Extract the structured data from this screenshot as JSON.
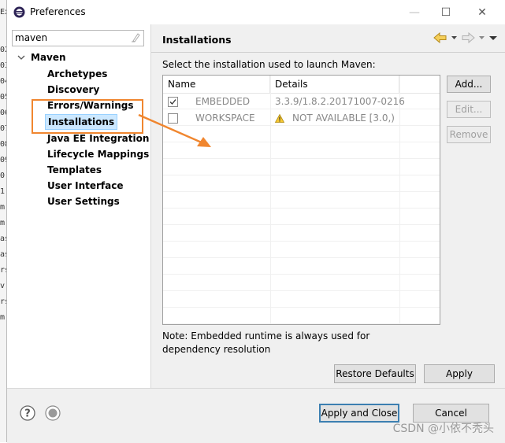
{
  "window": {
    "title": "Preferences",
    "controls": {
      "minimize": "—",
      "maximize": "☐",
      "close": "✕"
    }
  },
  "filter": {
    "value": "maven"
  },
  "tree": {
    "root_label": "Maven",
    "items": [
      {
        "label": "Archetypes"
      },
      {
        "label": "Discovery"
      },
      {
        "label": "Errors/Warnings"
      },
      {
        "label": "Installations"
      },
      {
        "label": "Java EE Integration"
      },
      {
        "label": "Lifecycle Mappings"
      },
      {
        "label": "Templates"
      },
      {
        "label": "User Interface"
      },
      {
        "label": "User Settings"
      }
    ],
    "selected": "Installations"
  },
  "page": {
    "title": "Installations",
    "description": "Select the installation used to launch Maven:",
    "table": {
      "columns": [
        "Name",
        "Details"
      ],
      "rows": [
        {
          "name": "EMBEDDED",
          "details": "3.3.9/1.8.2.20171007-0216",
          "checked": true,
          "warning": false
        },
        {
          "name": "WORKSPACE",
          "details": "NOT AVAILABLE [3.0,)",
          "checked": false,
          "warning": true
        }
      ]
    },
    "side_buttons": {
      "add": "Add...",
      "edit": "Edit...",
      "remove": "Remove"
    },
    "note": "Note: Embedded runtime is always used for dependency resolution",
    "restore_defaults": "Restore Defaults",
    "apply": "Apply"
  },
  "bottom": {
    "apply_and_close": "Apply and Close",
    "cancel": "Cancel"
  },
  "watermark": "CSDN @小依不秃头",
  "colors": {
    "accent": "#f0862f",
    "selection": "#cce8ff",
    "primary_border": "#3c7fb1"
  }
}
